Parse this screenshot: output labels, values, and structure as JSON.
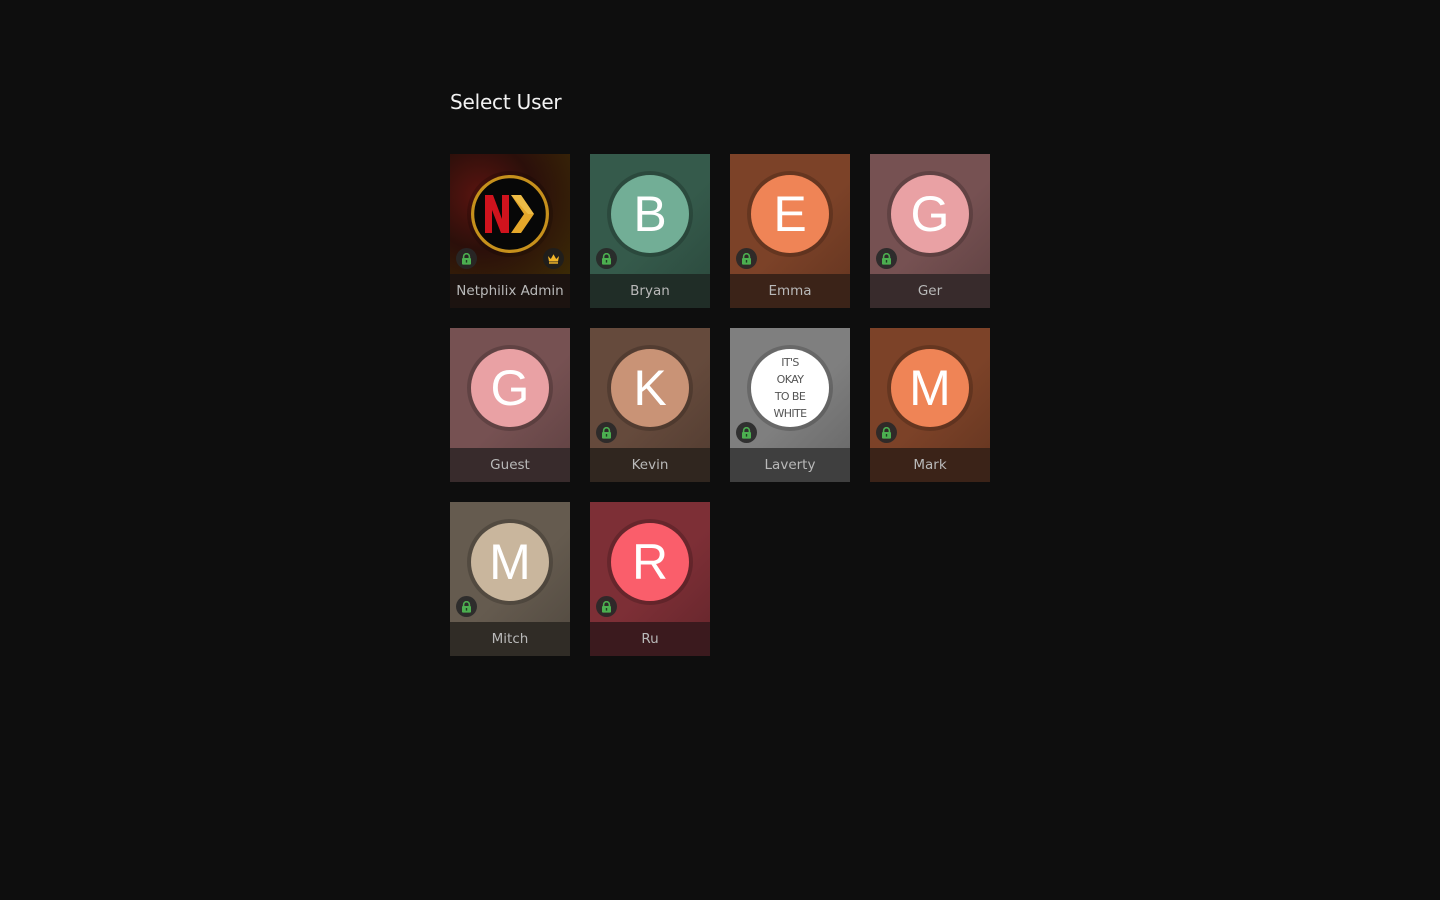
{
  "page": {
    "title": "Select User"
  },
  "colors": {
    "background": "#0e0e0e",
    "lock_green": "#4caf50",
    "crown_gold": "#f0b429"
  },
  "users": [
    {
      "name": "Netphilix Admin",
      "initial": "",
      "avatar_type": "logo",
      "logo_icon": "netphilix-logo-icon",
      "avatar_color": "#050505",
      "tile_color": "#3a1410",
      "label_bg": "#1c1310",
      "locked": true,
      "admin": true
    },
    {
      "name": "Bryan",
      "initial": "B",
      "avatar_type": "letter",
      "avatar_color": "#72ae96",
      "tile_color": "#355a4b",
      "label_bg": "#202d27",
      "locked": true,
      "admin": false
    },
    {
      "name": "Emma",
      "initial": "E",
      "avatar_type": "letter",
      "avatar_color": "#ef8456",
      "tile_color": "#7c4228",
      "label_bg": "#3b2318",
      "locked": true,
      "admin": false
    },
    {
      "name": "Ger",
      "initial": "G",
      "avatar_type": "letter",
      "avatar_color": "#e9a1a4",
      "tile_color": "#765152",
      "label_bg": "#382b2c",
      "locked": true,
      "admin": false
    },
    {
      "name": "Guest",
      "initial": "G",
      "avatar_type": "letter",
      "avatar_color": "#e9a1a4",
      "tile_color": "#765152",
      "label_bg": "#382b2c",
      "locked": false,
      "admin": false
    },
    {
      "name": "Kevin",
      "initial": "K",
      "avatar_type": "letter",
      "avatar_color": "#c99376",
      "tile_color": "#654a3c",
      "label_bg": "#30261f",
      "locked": true,
      "admin": false
    },
    {
      "name": "Laverty",
      "initial": "",
      "avatar_type": "text",
      "avatar_lines": [
        "IT'S",
        "OKAY",
        "TO BE",
        "WHITE"
      ],
      "avatar_color": "#ffffff",
      "tile_color": "#7f7f7f",
      "label_bg": "#3f3f3f",
      "locked": true,
      "admin": false
    },
    {
      "name": "Mark",
      "initial": "M",
      "avatar_type": "letter",
      "avatar_color": "#ef8456",
      "tile_color": "#7c4228",
      "label_bg": "#3b2318",
      "locked": true,
      "admin": false
    },
    {
      "name": "Mitch",
      "initial": "M",
      "avatar_type": "letter",
      "avatar_color": "#c9b69d",
      "tile_color": "#655b4f",
      "label_bg": "#302c26",
      "locked": true,
      "admin": false
    },
    {
      "name": "Ru",
      "initial": "R",
      "avatar_type": "letter",
      "avatar_color": "#fa5e6b",
      "tile_color": "#7d2f36",
      "label_bg": "#3b1a1e",
      "locked": true,
      "admin": false
    }
  ]
}
